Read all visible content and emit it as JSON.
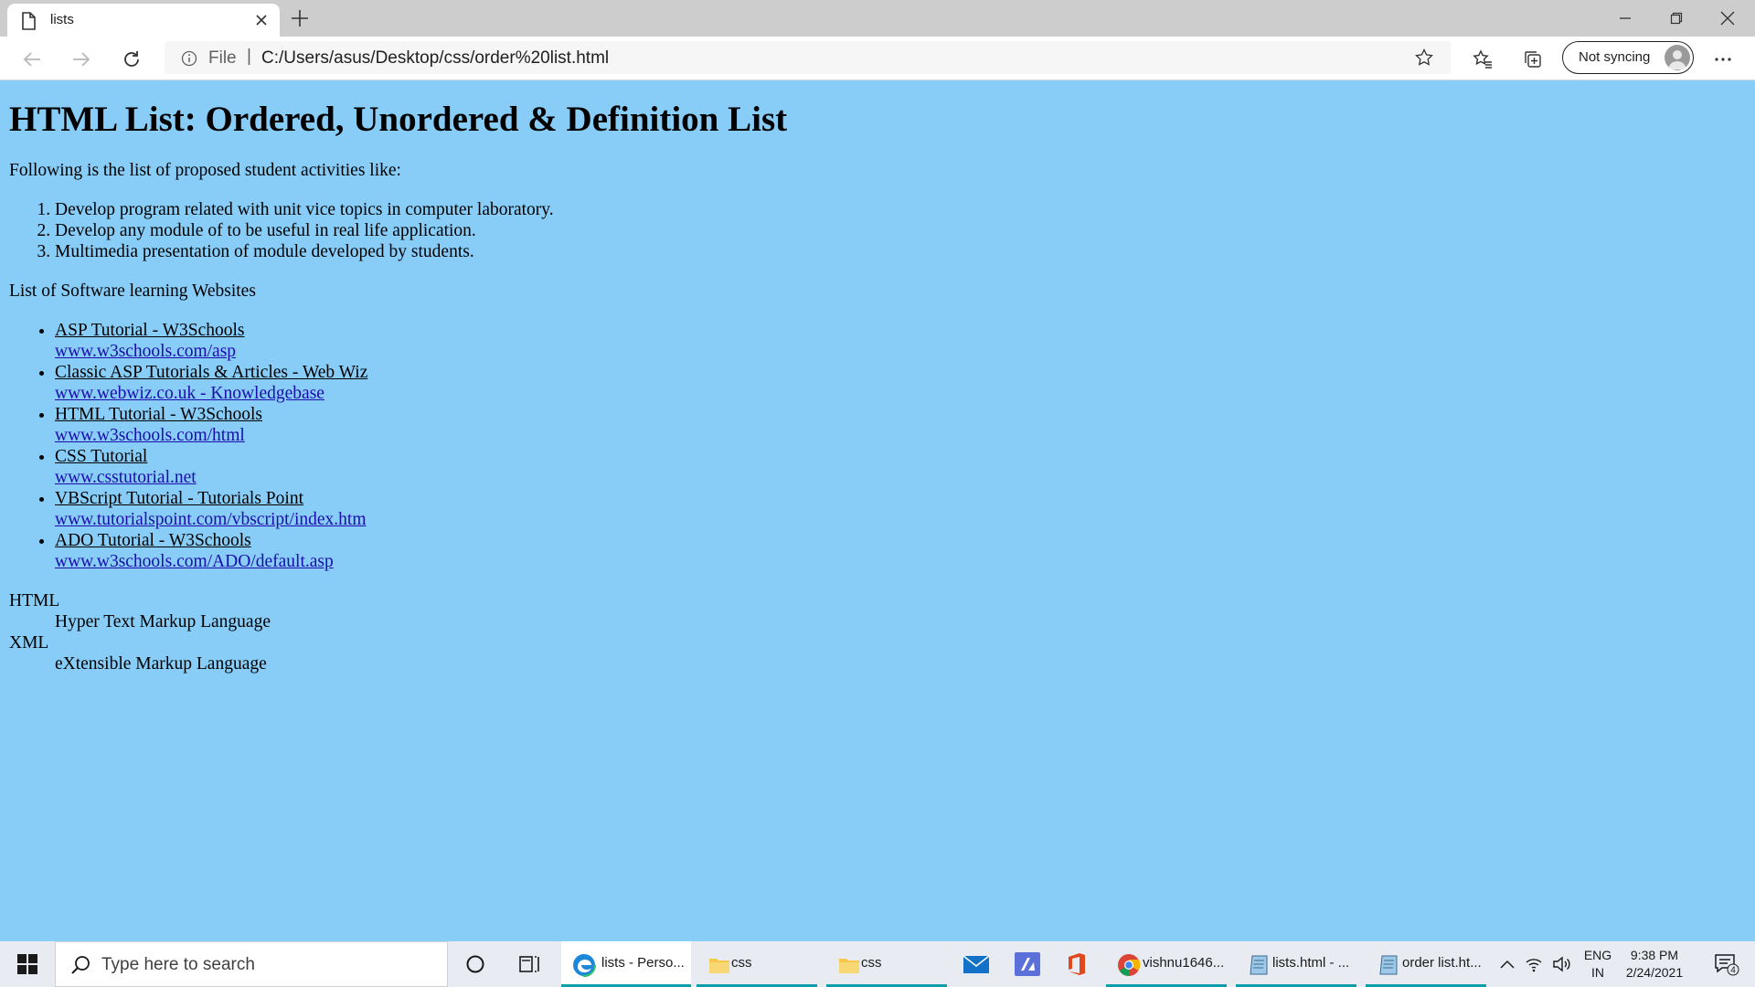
{
  "browser": {
    "tab": {
      "title": "lists"
    },
    "address": {
      "scheme_label": "File",
      "separator": "|",
      "url": "C:/Users/asus/Desktop/css/order%20list.html"
    },
    "profile": {
      "sync_label": "Not syncing"
    },
    "icons": [
      "page-icon",
      "close-icon",
      "plus-icon",
      "minimize-icon",
      "restore-icon",
      "close-window-icon",
      "back-icon",
      "forward-icon",
      "refresh-icon",
      "info-icon",
      "star-icon",
      "favorites-icon",
      "collections-icon",
      "more-icon"
    ]
  },
  "page": {
    "heading": "HTML List: Ordered, Unordered & Definition List",
    "intro": "Following is the list of proposed student activities like:",
    "ordered_items": [
      "Develop program related with unit vice topics in computer laboratory.",
      "Develop any module of to be useful in real life application.",
      "Multimedia presentation of module developed by students."
    ],
    "websites_heading": "List of Software learning Websites",
    "websites": [
      {
        "title": "ASP Tutorial - W3Schools",
        "url": "www.w3schools.com/asp"
      },
      {
        "title": "Classic ASP Tutorials & Articles - Web Wiz",
        "url": "www.webwiz.co.uk - Knowledgebase"
      },
      {
        "title": "HTML Tutorial - W3Schools",
        "url": "www.w3schools.com/html"
      },
      {
        "title": "CSS Tutorial",
        "url": "www.csstutorial.net"
      },
      {
        "title": "VBScript Tutorial - Tutorials Point",
        "url": "www.tutorialspoint.com/vbscript/index.htm"
      },
      {
        "title": "ADO Tutorial - W3Schools",
        "url": "www.w3schools.com/ADO/default.asp"
      }
    ],
    "definitions": [
      {
        "term": "HTML",
        "desc": "Hyper Text Markup Language"
      },
      {
        "term": "XML",
        "desc": "eXtensible Markup Language"
      }
    ],
    "background_color": "#88cdf8",
    "link_color": "#1a0dab"
  },
  "taskbar": {
    "search_placeholder": "Type here to search",
    "apps": [
      {
        "label": "lists - Perso...",
        "icon": "edge-icon"
      },
      {
        "label": "css",
        "icon": "folder-icon"
      },
      {
        "label": "css",
        "icon": "folder-icon"
      },
      {
        "label": "vishnu1646...",
        "icon": "chrome-icon"
      },
      {
        "label": "lists.html - ...",
        "icon": "notepad-icon"
      },
      {
        "label": "order list.ht...",
        "icon": "notepad-icon"
      }
    ],
    "pinned_icons": [
      "mail-icon",
      "azure-icon",
      "office-icon"
    ],
    "language": {
      "top": "ENG",
      "bottom": "IN"
    },
    "clock": {
      "time": "9:38 PM",
      "date": "2/24/2021"
    },
    "notification_count": "4",
    "accent_color": "#0e9daa"
  }
}
